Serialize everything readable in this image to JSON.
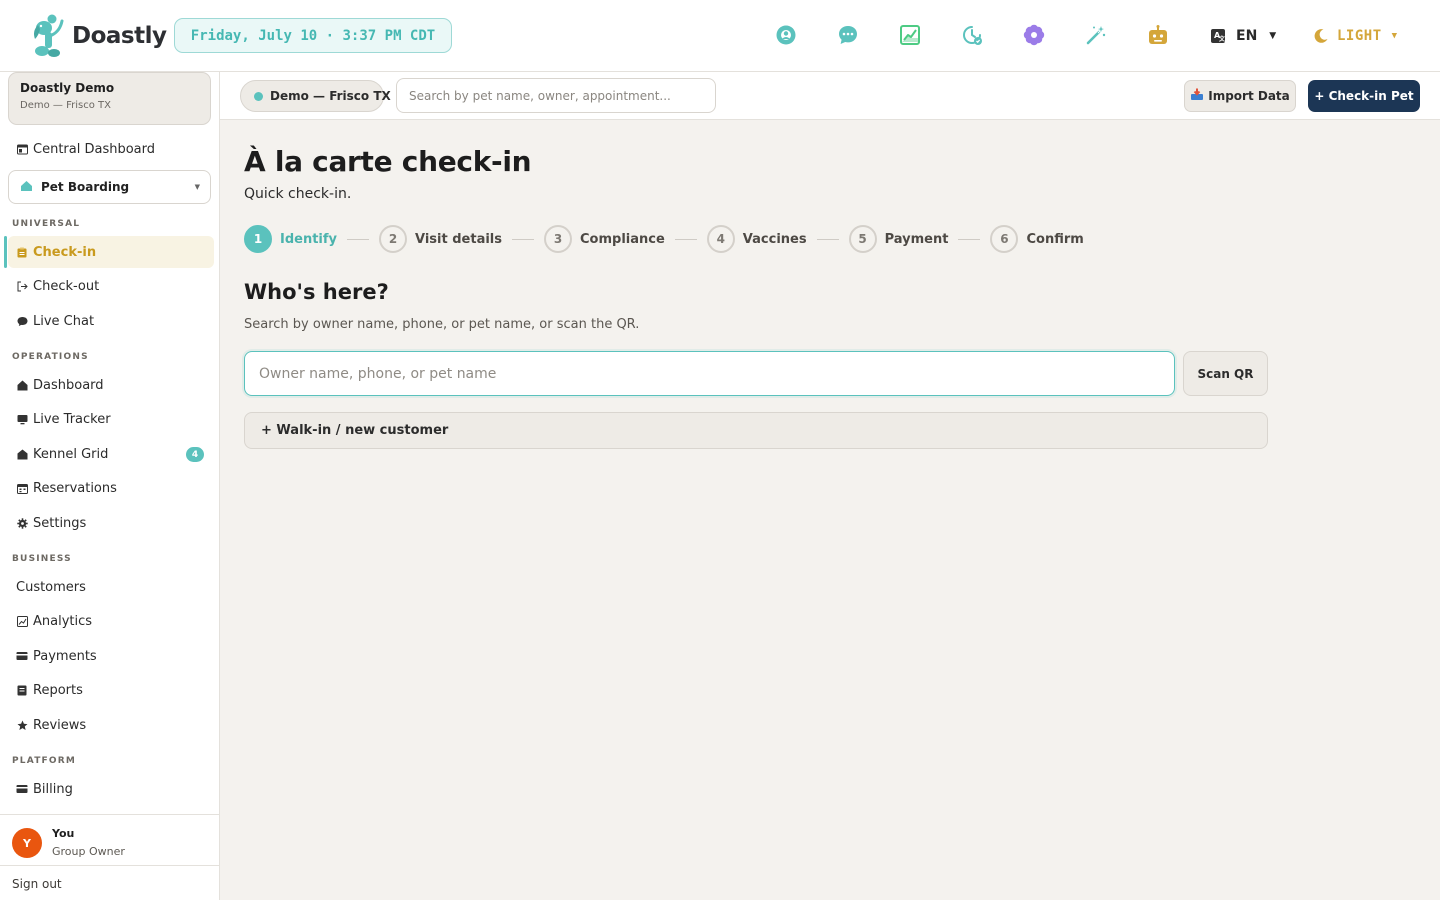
{
  "app": {
    "name": "Doastly",
    "datetime": "Friday, July 10 · 3:37 PM CDT"
  },
  "topbar": {
    "icons": [
      "support-icon",
      "chat-icon",
      "chart-icon",
      "clock-icon",
      "flower-icon",
      "magic-wand-icon",
      "robot-icon"
    ],
    "language": "EN",
    "theme": "LIGHT",
    "colors": {
      "accent": "#5bc2bd",
      "theme_accent": "#d4a63a",
      "primary_button": "#1c3655"
    }
  },
  "sidebar": {
    "org_name": "Doastly Demo",
    "org_location": "Demo — Frisco TX",
    "central_dashboard": "Central Dashboard",
    "module": "Pet Boarding",
    "sections": {
      "universal": "UNIVERSAL",
      "operations": "OPERATIONS",
      "business": "BUSINESS",
      "platform": "PLATFORM"
    },
    "items": {
      "checkin": "Check-in",
      "checkout": "Check-out",
      "live_chat": "Live Chat",
      "dashboard": "Dashboard",
      "live_tracker": "Live Tracker",
      "kennel_grid": "Kennel Grid",
      "kennel_badge": "4",
      "reservations": "Reservations",
      "settings": "Settings",
      "customers": "Customers",
      "analytics": "Analytics",
      "payments": "Payments",
      "reports": "Reports",
      "reviews": "Reviews",
      "billing": "Billing"
    },
    "user": {
      "initial": "Y",
      "name": "You",
      "role": "Group Owner"
    },
    "sign_out": "Sign out"
  },
  "subbar": {
    "location": "Demo — Frisco TX",
    "search_placeholder": "Search by pet name, owner, appointment...",
    "import_label": "Import Data",
    "checkin_label": "+ Check-in Pet"
  },
  "main": {
    "title": "À la carte check-in",
    "subtitle": "Quick check-in.",
    "steps": [
      {
        "num": "1",
        "label": "Identify"
      },
      {
        "num": "2",
        "label": "Visit details"
      },
      {
        "num": "3",
        "label": "Compliance"
      },
      {
        "num": "4",
        "label": "Vaccines"
      },
      {
        "num": "5",
        "label": "Payment"
      },
      {
        "num": "6",
        "label": "Confirm"
      }
    ],
    "active_step": 1,
    "section_title": "Who's here?",
    "section_sub": "Search by owner name, phone, or pet name, or scan the QR.",
    "owner_placeholder": "Owner name, phone, or pet name",
    "owner_value": "",
    "scan_label": "Scan QR",
    "walkin_label": "+ Walk-in / new customer"
  }
}
